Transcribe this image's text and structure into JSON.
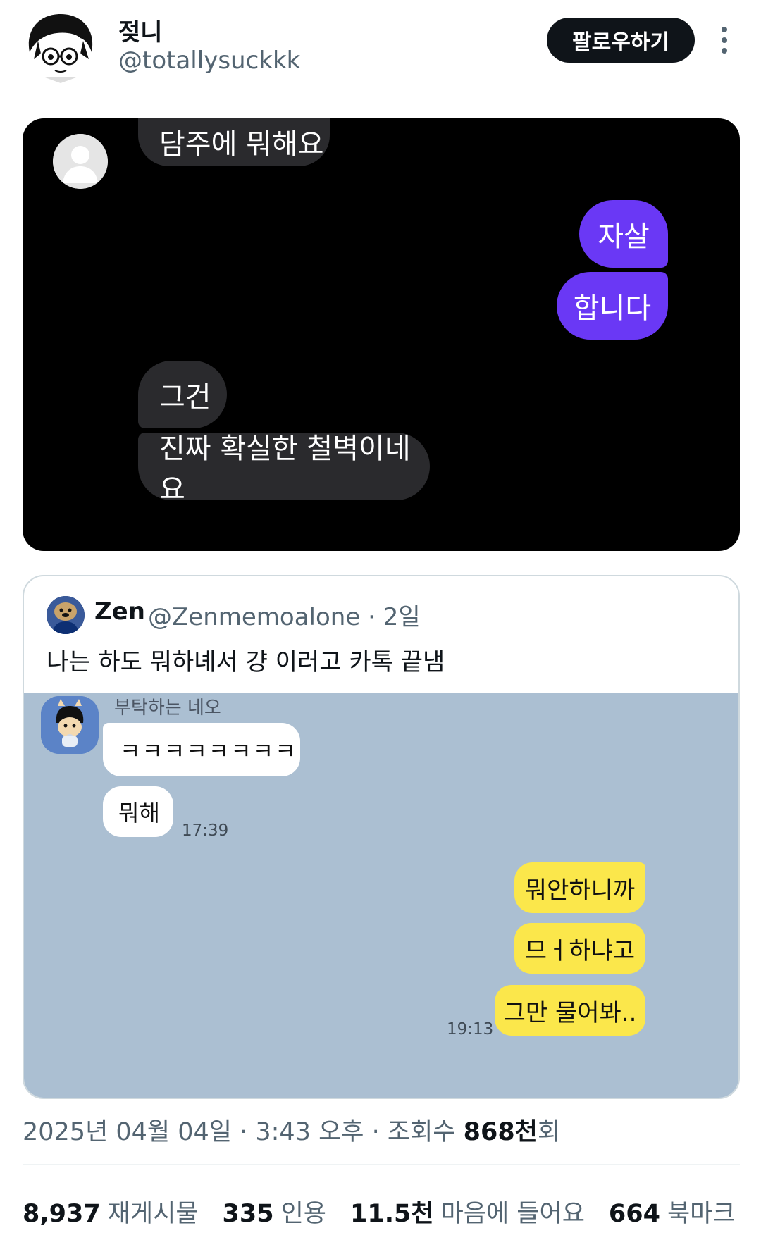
{
  "author": {
    "display_name": "젖니",
    "handle": "@totallysuckkk",
    "follow_label": "팔로우하기"
  },
  "dark_chat": {
    "messages": [
      {
        "from": "other",
        "text": "담주에 뭐해요"
      },
      {
        "from": "me",
        "text": "자살"
      },
      {
        "from": "me",
        "text": "합니다"
      },
      {
        "from": "other",
        "text": "그건"
      },
      {
        "from": "other",
        "text": "진짜 확실한 철벽이네요"
      }
    ],
    "colors": {
      "background": "#000000",
      "other_bubble": "#2a2a2d",
      "my_bubble": "#6a38f5"
    }
  },
  "quote": {
    "name": "Zen",
    "meta": "@Zenmemoalone · 2일",
    "text": "나는 하도 뭐하녜서 걍 이러고 카톡 끝냄",
    "kakao": {
      "sender": "부탁하는 네오",
      "incoming": [
        {
          "text": "ㅋㅋㅋㅋㅋㅋㅋㅋ"
        },
        {
          "text": "뭐해"
        }
      ],
      "incoming_time": "17:39",
      "outgoing": [
        {
          "text": "뭐안하니까"
        },
        {
          "text": "므ㅓ하냐고"
        },
        {
          "text": "그만 물어봐.."
        }
      ],
      "outgoing_time": "19:13",
      "colors": {
        "background": "#abbfd2",
        "my_bubble": "#fbe74b",
        "other_bubble": "#ffffff"
      }
    }
  },
  "timestamp": {
    "text": "2025년 04월 04일 · 3:43 오후 · 조회수 ",
    "views": "868천",
    "views_suffix": "회"
  },
  "stats": [
    {
      "value": "8,937",
      "label": "재게시물"
    },
    {
      "value": "335",
      "label": "인용"
    },
    {
      "value": "11.5천",
      "label": "마음에 들어요"
    },
    {
      "value": "664",
      "label": "북마크"
    }
  ]
}
